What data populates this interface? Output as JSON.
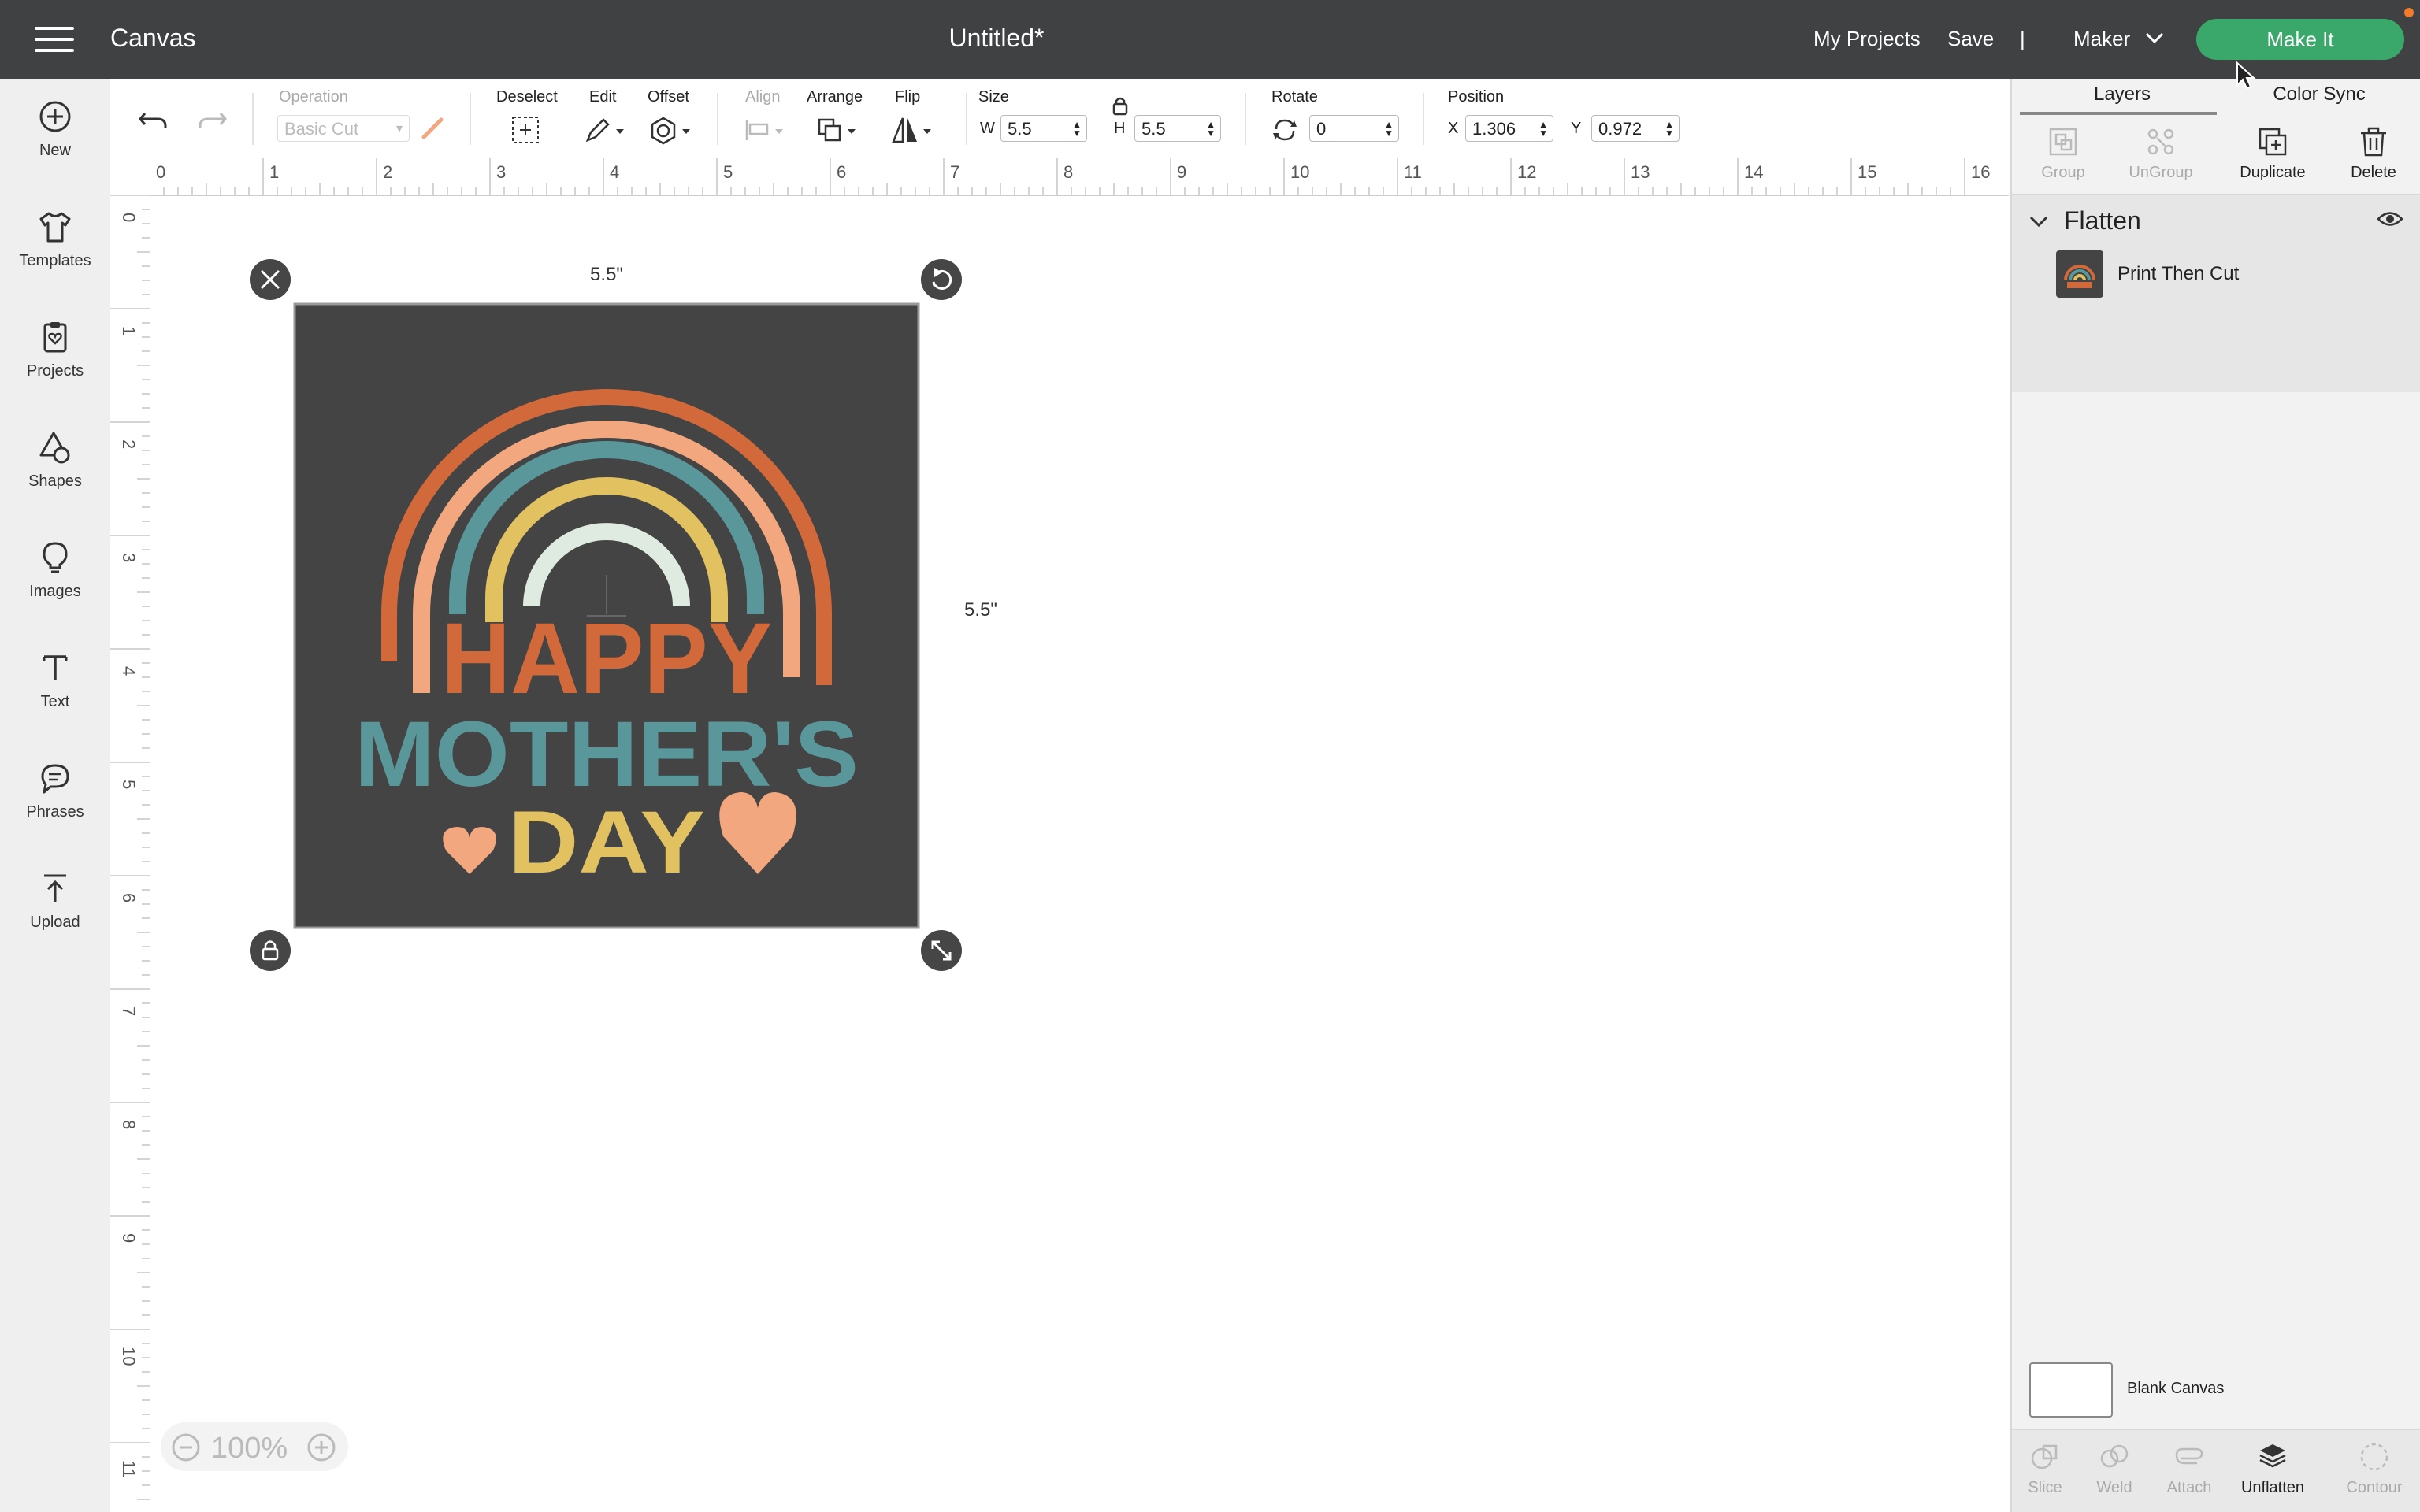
{
  "app": {
    "name": "Canvas",
    "document_title": "Untitled*"
  },
  "header": {
    "my_projects": "My Projects",
    "save": "Save",
    "divider": "|",
    "machine": "Maker",
    "make_it": "Make It"
  },
  "sidebar": {
    "items": [
      {
        "label": "New",
        "icon": "plus-circle-icon"
      },
      {
        "label": "Templates",
        "icon": "tshirt-icon"
      },
      {
        "label": "Projects",
        "icon": "clipboard-heart-icon"
      },
      {
        "label": "Shapes",
        "icon": "shapes-icon"
      },
      {
        "label": "Images",
        "icon": "lightbulb-icon"
      },
      {
        "label": "Text",
        "icon": "text-t-icon"
      },
      {
        "label": "Phrases",
        "icon": "speech-bubble-icon"
      },
      {
        "label": "Upload",
        "icon": "upload-icon"
      }
    ]
  },
  "toolbar": {
    "operation_label": "Operation",
    "operation_value": "Basic Cut",
    "deselect": "Deselect",
    "edit": "Edit",
    "offset": "Offset",
    "align": "Align",
    "arrange": "Arrange",
    "flip": "Flip",
    "size_label": "Size",
    "w_label": "W",
    "w_value": "5.5",
    "h_label": "H",
    "h_value": "5.5",
    "rotate_label": "Rotate",
    "rotate_value": "0",
    "position_label": "Position",
    "x_label": "X",
    "x_value": "1.306",
    "y_label": "Y",
    "y_value": "0.972"
  },
  "rulers": {
    "horizontal": [
      "0",
      "1",
      "2",
      "3",
      "4",
      "5",
      "6",
      "7",
      "8",
      "9",
      "10",
      "11",
      "12",
      "13",
      "14",
      "15",
      "16"
    ],
    "vertical": [
      "0",
      "1",
      "2",
      "3",
      "4",
      "5",
      "6",
      "7",
      "8",
      "9",
      "10",
      "11"
    ]
  },
  "canvas": {
    "width_label": "5.5\"",
    "height_label": "5.5\"",
    "design_text": {
      "line1": "HAPPY",
      "line2": "MOTHER'S",
      "line3": "DAY"
    },
    "zoom": "100%",
    "colors": {
      "background": "#444444",
      "orange": "#d2693a",
      "peach": "#f2a77e",
      "teal": "#5a979b",
      "mustard": "#e2c260",
      "mint": "#dfeae1"
    }
  },
  "panel": {
    "tabs": [
      "Layers",
      "Color Sync"
    ],
    "tools": [
      "Group",
      "UnGroup",
      "Duplicate",
      "Delete"
    ],
    "group_name": "Flatten",
    "layer_name": "Print Then Cut",
    "blank_canvas": "Blank Canvas",
    "bottom_tools": [
      "Slice",
      "Weld",
      "Attach",
      "Unflatten",
      "Contour"
    ]
  }
}
